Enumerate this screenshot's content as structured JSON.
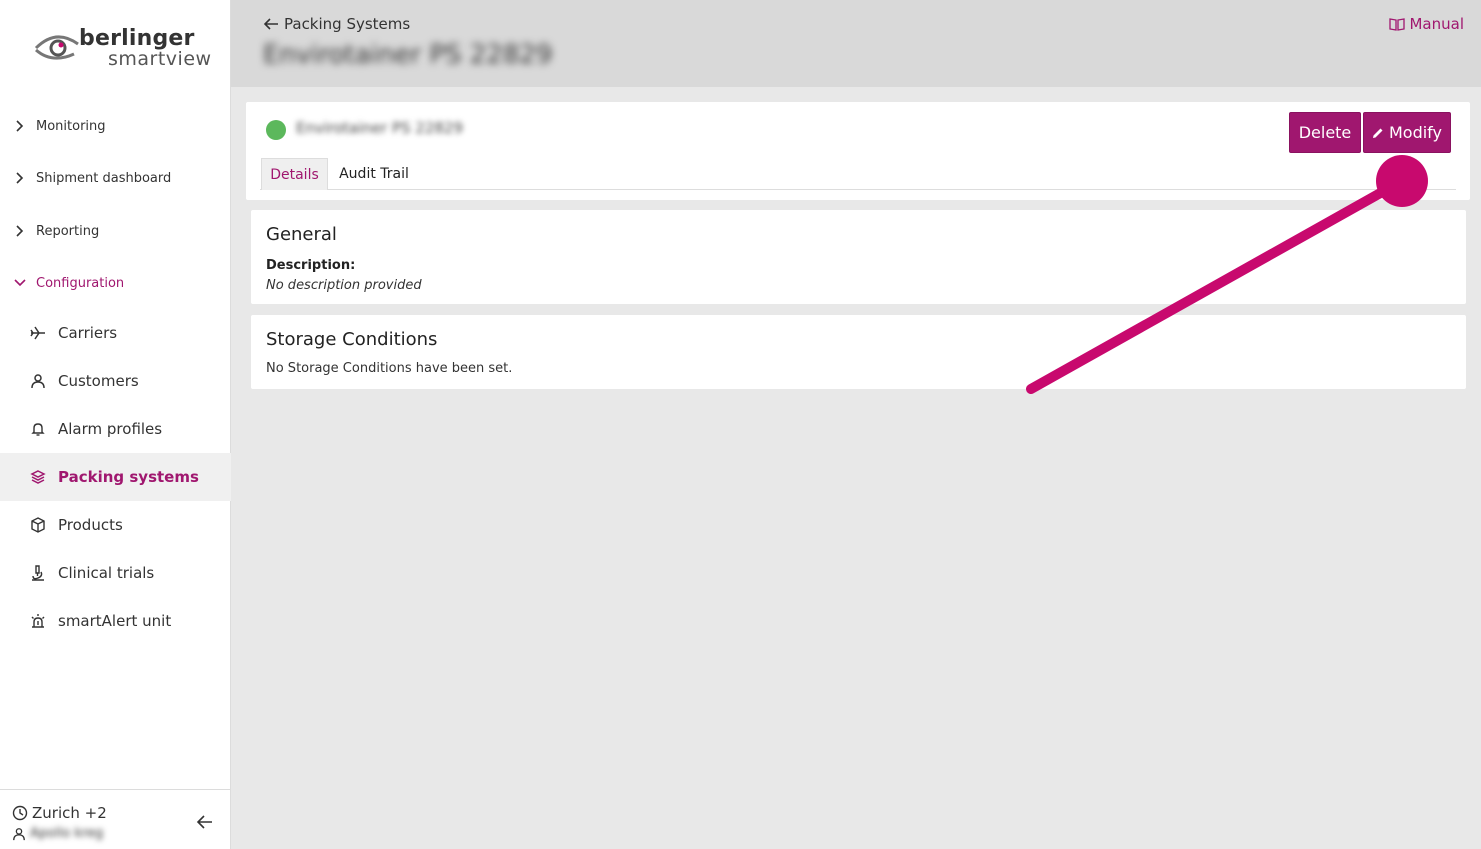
{
  "brand": {
    "name_line1": "berlinger",
    "name_line2": "smartview"
  },
  "sidebar": {
    "groups": [
      {
        "label": "Monitoring",
        "expanded": false
      },
      {
        "label": "Shipment dashboard",
        "expanded": false
      },
      {
        "label": "Reporting",
        "expanded": false
      },
      {
        "label": "Configuration",
        "expanded": true
      }
    ],
    "items": [
      {
        "label": "Carriers",
        "icon": "airplane-icon"
      },
      {
        "label": "Customers",
        "icon": "person-icon"
      },
      {
        "label": "Alarm profiles",
        "icon": "bell-icon"
      },
      {
        "label": "Packing systems",
        "icon": "packing-box-icon",
        "active": true
      },
      {
        "label": "Products",
        "icon": "cube-icon"
      },
      {
        "label": "Clinical trials",
        "icon": "microscope-icon"
      },
      {
        "label": "smartAlert unit",
        "icon": "alarm-light-icon"
      }
    ],
    "footer": {
      "timezone": "Zurich +2",
      "username": "Apollo kreg"
    }
  },
  "header": {
    "back_label": "Packing Systems",
    "title": "Envirotainer PS 22829",
    "manual_label": "Manual"
  },
  "detail": {
    "name": "Envirotainer PS 22829",
    "status_color": "#5cb85c",
    "delete_label": "Delete",
    "modify_label": "Modify",
    "tabs": [
      {
        "label": "Details",
        "active": true
      },
      {
        "label": "Audit Trail",
        "active": false
      }
    ]
  },
  "general": {
    "title": "General",
    "description_label": "Description:",
    "description_value": "No description provided"
  },
  "storage": {
    "title": "Storage Conditions",
    "empty_text": "No Storage Conditions have been set."
  },
  "colors": {
    "accent": "#a0176f",
    "annotation": "#c8096e",
    "status_ok": "#5cb85c"
  }
}
